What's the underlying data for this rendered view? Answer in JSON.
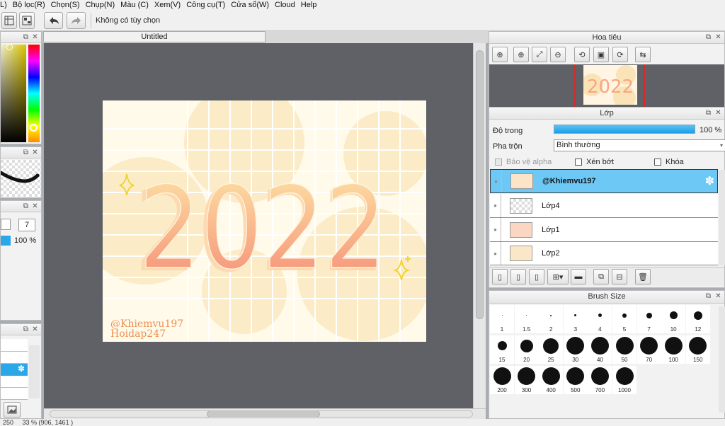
{
  "menu": [
    "L)",
    "Bộ lọc(R)",
    "Chọn(S)",
    "Chụp(N)",
    "Màu (C)",
    "Xem(V)",
    "Công cụ(T)",
    "Cửa sổ(W)",
    "Cloud",
    "Help"
  ],
  "toolbar": {
    "options_text": "Không có tùy chọn"
  },
  "document": {
    "tab_title": "Untitled",
    "artwork_year": "2022",
    "signature_line1": "@Khiemvu197",
    "signature_line2": "Hoidap247"
  },
  "left_panel": {
    "brush_size_value": "7",
    "opacity_value": "100 %"
  },
  "navigator": {
    "title": "Hoa tiêu"
  },
  "layers": {
    "title": "Lớp",
    "opacity_label": "Độ trong",
    "opacity_value": "100 %",
    "opacity_fraction": 1.0,
    "blend_label": "Pha trộn",
    "blend_value": "Bình thường",
    "protect_alpha": "Bảo vệ alpha",
    "clipping": "Xén bớt",
    "lock": "Khóa",
    "items": [
      {
        "name": "@Khiemvu197",
        "selected": true
      },
      {
        "name": "Lớp4",
        "selected": false
      },
      {
        "name": "Lớp1",
        "selected": false
      },
      {
        "name": "Lớp2",
        "selected": false
      }
    ]
  },
  "brush_size": {
    "title": "Brush Size",
    "sizes": [
      "1",
      "1.5",
      "2",
      "3",
      "4",
      "5",
      "7",
      "10",
      "12",
      "15",
      "20",
      "25",
      "30",
      "40",
      "50",
      "70",
      "100",
      "150",
      "200",
      "300",
      "400",
      "500",
      "700",
      "1000"
    ]
  },
  "colors": {
    "selection": "#6ec8f5",
    "accent": "#29a7e8",
    "canvas_bg": "#5f6166"
  },
  "status": {
    "text": "250     33 % (906, 1461 )"
  }
}
